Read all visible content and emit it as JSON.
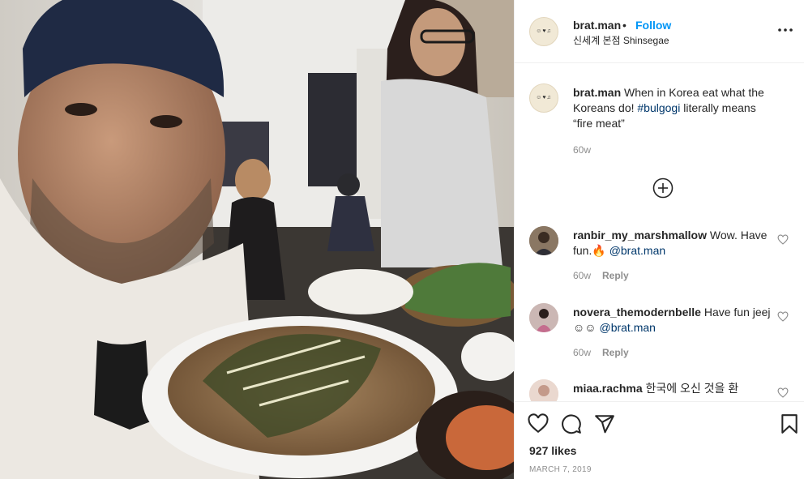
{
  "post": {
    "username": "brat.man",
    "separator": "•",
    "follow_label": "Follow",
    "location": "신세계 본점 Shinsegae",
    "more_icon": "more-horizontal-icon"
  },
  "caption": {
    "username": "brat.man",
    "text_before": " When in Korea eat what the Koreans do! ",
    "hashtag": "#bulgogi",
    "text_after": " literally means “fire meat”",
    "time": "60w"
  },
  "load_more_icon": "plus-circle-icon",
  "comments": [
    {
      "username": "ranbir_my_marshmallow",
      "text": " Wow. Have fun.🔥 ",
      "mention": "@brat.man",
      "time": "60w",
      "reply_label": "Reply"
    },
    {
      "username": "novera_themodernbelle",
      "text": " Have fun jeej ☺☺ ",
      "mention": "@brat.man",
      "time": "60w",
      "reply_label": "Reply"
    },
    {
      "username": "miaa.rachma",
      "text": " 한국에 오신 것을 환"
    }
  ],
  "actions": {
    "like_icon": "heart-icon",
    "comment_icon": "comment-icon",
    "share_icon": "paper-plane-icon",
    "save_icon": "bookmark-icon",
    "likes": "927 likes",
    "date": "MARCH 7, 2019"
  },
  "colors": {
    "link_blue": "#0095f6",
    "mention_blue": "#00376b",
    "muted": "#8e8e8e",
    "border": "#efefef"
  }
}
